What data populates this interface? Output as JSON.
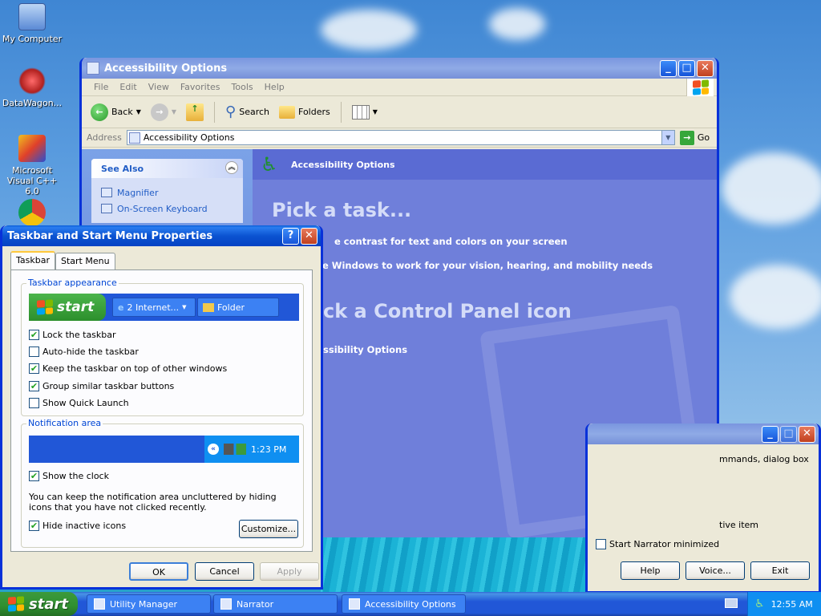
{
  "desktop": {
    "icons": [
      {
        "label": "My Computer"
      },
      {
        "label": "DataWagon..."
      },
      {
        "label": "Microsoft Visual C++ 6.0"
      },
      {
        "label": ""
      }
    ]
  },
  "explorer": {
    "title": "Accessibility Options",
    "menu": [
      "File",
      "Edit",
      "View",
      "Favorites",
      "Tools",
      "Help"
    ],
    "toolbar": {
      "back": "Back",
      "search": "Search",
      "folders": "Folders"
    },
    "address": {
      "label": "Address",
      "value": "Accessibility Options",
      "go": "Go"
    },
    "see_also": {
      "title": "See Also",
      "items": [
        "Magnifier",
        "On-Screen Keyboard"
      ]
    },
    "pane_title": "Accessibility Options",
    "pick_task": "Pick a task...",
    "tasks": [
      "e contrast for text and colors on your screen",
      "e Windows to work for your vision, hearing, and mobility needs"
    ],
    "pick_icon": "ck a Control Panel icon",
    "icons": [
      "ssibility Options"
    ]
  },
  "narrator": {
    "text1": "mmands, dialog box",
    "text2": "tive item",
    "checkbox": "Start Narrator minimized",
    "buttons": {
      "help": "Help",
      "voice": "Voice...",
      "exit": "Exit"
    }
  },
  "taskprops": {
    "title": "Taskbar and Start Menu Properties",
    "tabs": [
      "Taskbar",
      "Start Menu"
    ],
    "appearance": {
      "title": "Taskbar appearance",
      "preview_start": "start",
      "preview_ie": "2 Internet...",
      "preview_folder": "Folder",
      "options": [
        {
          "label": "Lock the taskbar",
          "checked": true
        },
        {
          "label": "Auto-hide the taskbar",
          "checked": false
        },
        {
          "label": "Keep the taskbar on top of other windows",
          "checked": true
        },
        {
          "label": "Group similar taskbar buttons",
          "checked": true
        },
        {
          "label": "Show Quick Launch",
          "checked": false
        }
      ]
    },
    "notification": {
      "title": "Notification area",
      "preview_time": "1:23 PM",
      "show_clock": "Show the clock",
      "description": "You can keep the notification area uncluttered by hiding icons that you have not clicked recently.",
      "hide_inactive": "Hide inactive icons",
      "customize": "Customize..."
    },
    "buttons": {
      "ok": "OK",
      "cancel": "Cancel",
      "apply": "Apply"
    }
  },
  "taskbar": {
    "start": "start",
    "items": [
      "Utility Manager",
      "Narrator",
      "Accessibility Options"
    ],
    "clock": "12:55 AM"
  }
}
